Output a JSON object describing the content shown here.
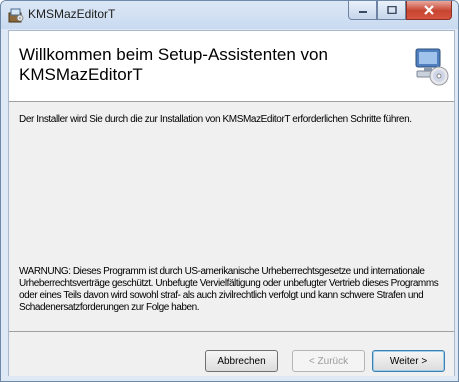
{
  "window": {
    "title": "KMSMazEditorT"
  },
  "header": {
    "title": "Willkommen beim Setup-Assistenten von KMSMazEditorT"
  },
  "body": {
    "intro": "Der Installer wird Sie durch die zur Installation von KMSMazEditorT erforderlichen Schritte führen.",
    "warning": "WARNUNG: Dieses Programm ist durch US-amerikanische Urheberrechtsgesetze und internationale Urheberrechtsverträge geschützt. Unbefugte Vervielfältigung oder unbefugter Vertrieb dieses Programms oder eines Teils davon wird sowohl straf- als auch zivilrechtlich verfolgt und kann schwere Strafen und Schadenersatzforderungen zur Folge haben."
  },
  "buttons": {
    "cancel": "Abbrechen",
    "back": "< Zurück",
    "next": "Weiter >"
  },
  "icons": {
    "app": "installer-icon",
    "header": "computer-cd-icon"
  }
}
